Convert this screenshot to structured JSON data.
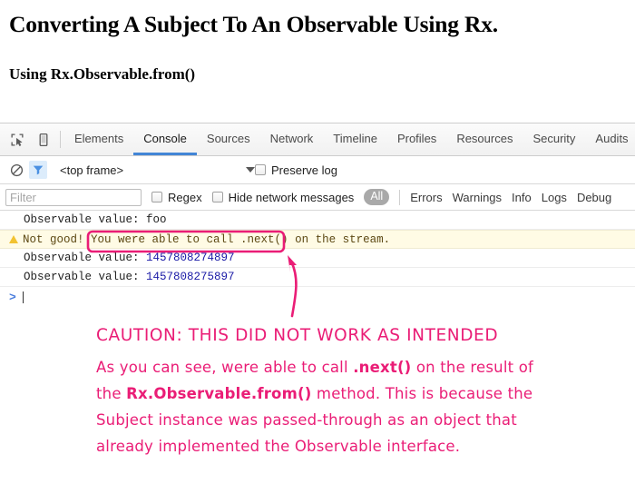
{
  "article": {
    "title": "Converting A Subject To An Observable Using Rx.",
    "subtitle": "Using Rx.Observable.from()"
  },
  "devtools": {
    "toolbar_icons": [
      {
        "name": "inspect-element-icon",
        "glyph": "inspect"
      },
      {
        "name": "device-toolbar-icon",
        "glyph": "device"
      }
    ],
    "tabs": [
      {
        "label": "Elements",
        "active": false
      },
      {
        "label": "Console",
        "active": true
      },
      {
        "label": "Sources",
        "active": false
      },
      {
        "label": "Network",
        "active": false
      },
      {
        "label": "Timeline",
        "active": false
      },
      {
        "label": "Profiles",
        "active": false
      },
      {
        "label": "Resources",
        "active": false
      },
      {
        "label": "Security",
        "active": false
      },
      {
        "label": "Audits",
        "active": false
      }
    ],
    "framebar": {
      "clear_icon": "clear-console-icon",
      "filter_icon": "filter-funnel-icon",
      "context_value": "<top frame>",
      "preserve_log_label": "Preserve log",
      "preserve_log_checked": false
    },
    "filterbar": {
      "filter_placeholder": "Filter",
      "filter_value": "",
      "regex_label": "Regex",
      "regex_checked": false,
      "hide_network_label": "Hide network messages",
      "hide_network_checked": false,
      "levels": [
        "All",
        "Errors",
        "Warnings",
        "Info",
        "Logs",
        "Debug"
      ],
      "active_level": "All"
    },
    "console_messages": [
      {
        "type": "log",
        "text": "Observable value: foo"
      },
      {
        "type": "warning",
        "prefix": "Not good! ",
        "highlight": "You were able to call .next()",
        "suffix": " on the stream."
      },
      {
        "type": "log",
        "label": "Observable value: ",
        "value": "1457808274897"
      },
      {
        "type": "log",
        "label": "Observable value: ",
        "value": "1457808275897"
      }
    ],
    "prompt": {
      "chevron": ">",
      "value": ""
    }
  },
  "annotation": {
    "color": "#ea1d76",
    "heading": "CAUTION: THIS DID NOT WORK AS INTENDED",
    "line1_a": "As you can see, were able to call ",
    "line1_b": ".next()",
    "line1_c": " on the result of",
    "line2_a": "the ",
    "line2_b": "Rx.Observable.from()",
    "line2_c": " method. This is because the",
    "line3": "Subject instance was passed-through as an object that",
    "line4": "already implemented the Observable interface."
  }
}
